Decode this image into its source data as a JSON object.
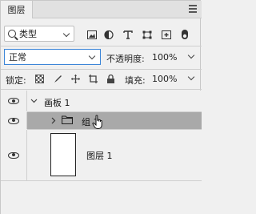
{
  "panel": {
    "tab_label": "图层"
  },
  "filter": {
    "kind_label": "类型",
    "icons": [
      "image-filter-icon",
      "adjustment-filter-icon",
      "text-filter-icon",
      "shape-filter-icon",
      "smart-object-filter-icon",
      "filter-toggle-icon"
    ]
  },
  "blend": {
    "mode": "正常",
    "opacity_label": "不透明度:",
    "opacity_value": "100%"
  },
  "lock": {
    "label": "锁定:",
    "icons": [
      "lock-transparent-icon",
      "lock-paint-icon",
      "lock-position-icon",
      "lock-artboard-icon",
      "lock-all-icon"
    ],
    "fill_label": "填充:",
    "fill_value": "100%"
  },
  "layers": [
    {
      "name": "画板 1",
      "type": "artboard",
      "expanded": true,
      "visible": true,
      "selected": false
    },
    {
      "name": "组 1",
      "type": "group",
      "expanded": false,
      "visible": true,
      "selected": true
    },
    {
      "name": "图层 1",
      "type": "layer",
      "visible": true,
      "selected": false
    }
  ],
  "colors": {
    "panel_bg": "#f0f0f0",
    "selected_row": "#a9a9a9",
    "focus_border": "#3c86d8"
  }
}
